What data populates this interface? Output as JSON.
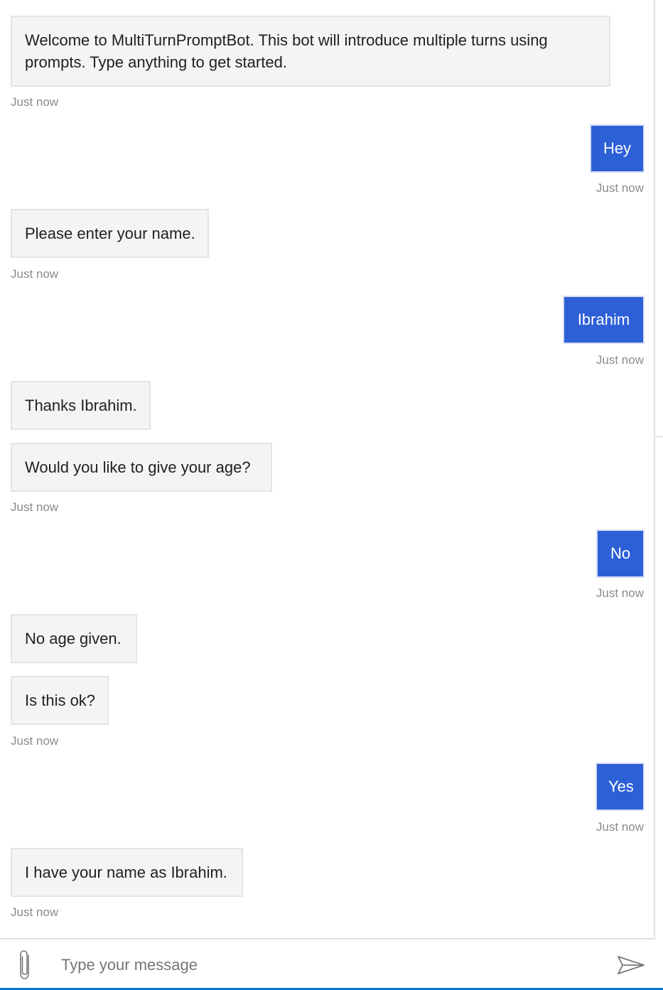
{
  "messages": [
    {
      "from": "bot",
      "text": "Welcome to MultiTurnPromptBot. This bot will introduce multiple turns using prompts. Type anything to get started.",
      "timestamp": "Just now"
    },
    {
      "from": "user",
      "text": "Hey",
      "timestamp": "Just now"
    },
    {
      "from": "bot",
      "text": "Please enter your name.",
      "timestamp": "Just now"
    },
    {
      "from": "user",
      "text": "Ibrahim",
      "timestamp": "Just now"
    },
    {
      "from": "bot",
      "text": "Thanks Ibrahim."
    },
    {
      "from": "bot",
      "text": "Would you like to give your age?",
      "timestamp": "Just now"
    },
    {
      "from": "user",
      "text": "No",
      "timestamp": "Just now"
    },
    {
      "from": "bot",
      "text": "No age given."
    },
    {
      "from": "bot",
      "text": "Is this ok?",
      "timestamp": "Just now"
    },
    {
      "from": "user",
      "text": "Yes",
      "timestamp": "Just now"
    },
    {
      "from": "bot",
      "text": "I have your name as Ibrahim.",
      "timestamp": "Just now"
    }
  ],
  "composer": {
    "placeholder": "Type your message",
    "value": "",
    "attach_icon": "paperclip-icon",
    "send_icon": "send-icon"
  },
  "colors": {
    "user_bubble": "#2d5fd7",
    "bot_bubble": "#f4f4f4",
    "accent": "#0078d7"
  }
}
